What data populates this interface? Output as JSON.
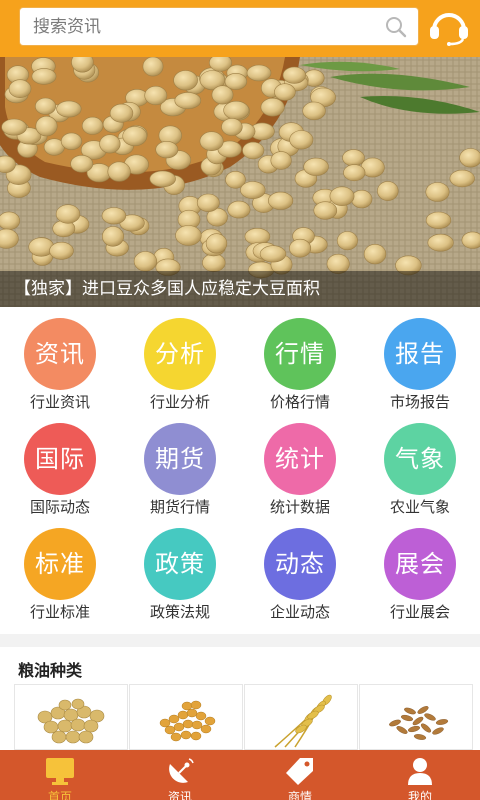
{
  "header": {
    "search_placeholder": "搜索资讯",
    "search_icon": "search-icon",
    "service_icon": "headset-icon"
  },
  "banner": {
    "caption": "【独家】进口豆众多国人应稳定大豆面积"
  },
  "categories": [
    {
      "icon_text": "资讯",
      "label": "行业资讯",
      "color": "#f38b62"
    },
    {
      "icon_text": "分析",
      "label": "行业分析",
      "color": "#f5d630"
    },
    {
      "icon_text": "行情",
      "label": "价格行情",
      "color": "#5fc35b"
    },
    {
      "icon_text": "报告",
      "label": "市场报告",
      "color": "#4aa6ef"
    },
    {
      "icon_text": "国际",
      "label": "国际动态",
      "color": "#ee5b57"
    },
    {
      "icon_text": "期货",
      "label": "期货行情",
      "color": "#8f8ed2"
    },
    {
      "icon_text": "统计",
      "label": "统计数据",
      "color": "#ee6aa8"
    },
    {
      "icon_text": "气象",
      "label": "农业气象",
      "color": "#5dd3a2"
    },
    {
      "icon_text": "标准",
      "label": "行业标准",
      "color": "#f5a623"
    },
    {
      "icon_text": "政策",
      "label": "政策法规",
      "color": "#46c9c1"
    },
    {
      "icon_text": "动态",
      "label": "企业动态",
      "color": "#6d6ee0"
    },
    {
      "icon_text": "展会",
      "label": "行业展会",
      "color": "#bd5fd6"
    }
  ],
  "grain_section": {
    "title": "粮油种类",
    "products": [
      {
        "name": "soybean-image"
      },
      {
        "name": "corn-image"
      },
      {
        "name": "wheat-image"
      },
      {
        "name": "rice-image"
      }
    ]
  },
  "tabbar": {
    "accent": "#d4572b",
    "active_color": "#f6c23a",
    "tabs": [
      {
        "label": "首页",
        "icon": "monitor-icon",
        "active": true
      },
      {
        "label": "资讯",
        "icon": "satellite-dish-icon",
        "active": false
      },
      {
        "label": "商情",
        "icon": "price-tag-icon",
        "active": false
      },
      {
        "label": "我的",
        "icon": "user-icon",
        "active": false
      }
    ]
  }
}
